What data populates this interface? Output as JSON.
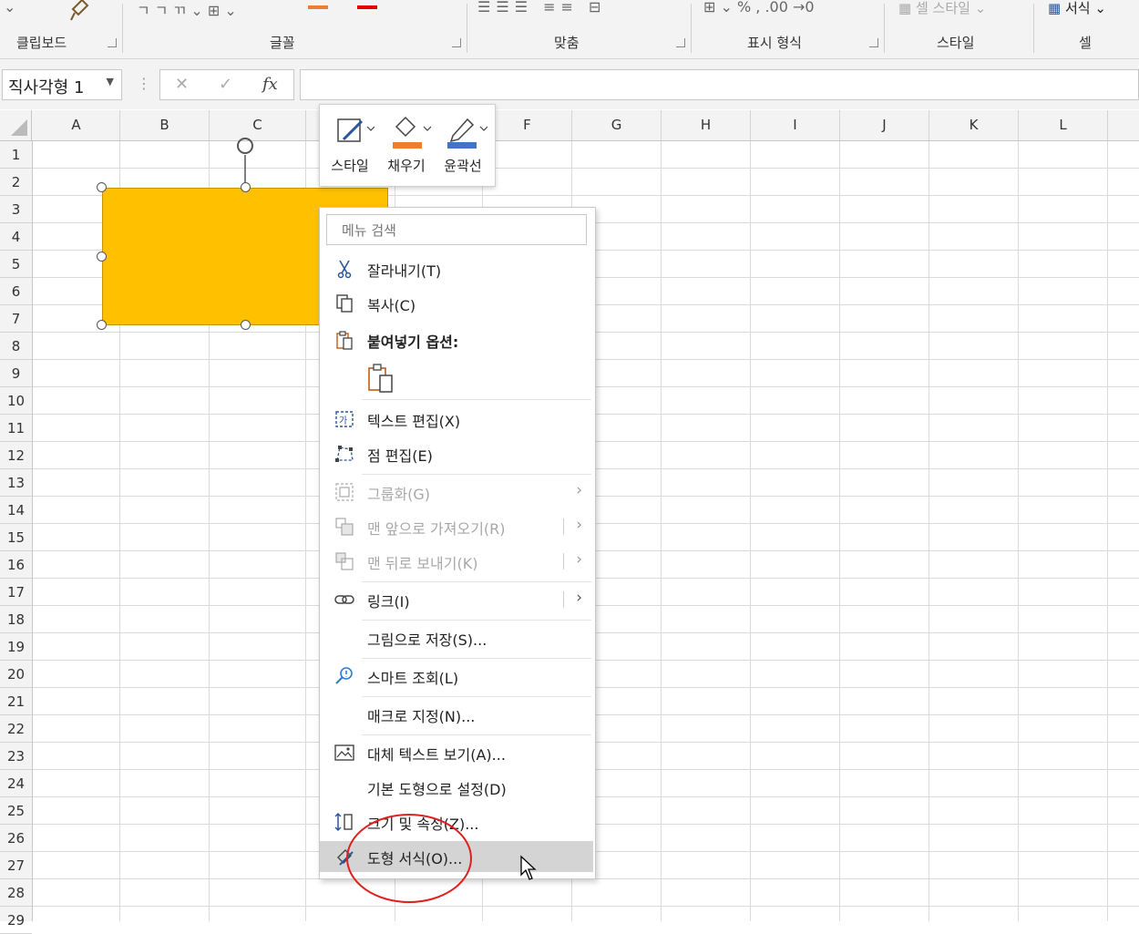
{
  "ribbon": {
    "groups": [
      {
        "label": "클립보드"
      },
      {
        "label": "글꼴"
      },
      {
        "label": "맞춤"
      },
      {
        "label": "표시 형식"
      },
      {
        "label": "스타일"
      },
      {
        "label": "셀"
      }
    ],
    "cell_style_label": "셀 스타일",
    "format_label": "서식"
  },
  "formula_bar": {
    "name_box": "직사각형 1",
    "cancel_glyph": "✕",
    "enter_glyph": "✓",
    "fx_glyph": "fx",
    "formula": ""
  },
  "columns": [
    "A",
    "B",
    "C",
    "D",
    "E",
    "F",
    "G",
    "H",
    "I",
    "J",
    "K",
    "L"
  ],
  "rows": [
    "1",
    "2",
    "3",
    "4",
    "5",
    "6",
    "7",
    "8",
    "9",
    "10",
    "11",
    "12",
    "13",
    "14",
    "15",
    "16",
    "17",
    "18",
    "19",
    "20",
    "21",
    "22",
    "23",
    "24",
    "25",
    "26",
    "27",
    "28",
    "29"
  ],
  "shape": {
    "fill_color": "#ffc000"
  },
  "mini_toolbar": {
    "style": "스타일",
    "fill": "채우기",
    "outline": "윤곽선",
    "fill_color": "#ed7d31",
    "outline_color": "#4472c4"
  },
  "context_menu": {
    "search_placeholder": "메뉴 검색",
    "cut": "잘라내기(T)",
    "copy": "복사(C)",
    "paste_options": "붙여넣기 옵션:",
    "edit_text": "텍스트 편집(X)",
    "edit_points": "점 편집(E)",
    "group": "그룹화(G)",
    "bring_to_front": "맨 앞으로 가져오기(R)",
    "send_to_back": "맨 뒤로 보내기(K)",
    "link": "링크(I)",
    "save_as_picture": "그림으로 저장(S)...",
    "smart_lookup": "스마트 조회(L)",
    "assign_macro": "매크로 지정(N)...",
    "alt_text": "대체 텍스트 보기(A)...",
    "set_default_shape": "기본 도형으로 설정(D)",
    "size_properties": "크기 및 속성(Z)...",
    "format_shape": "도형 서식(O)..."
  },
  "annotation": {
    "circle_color": "#e02020"
  }
}
